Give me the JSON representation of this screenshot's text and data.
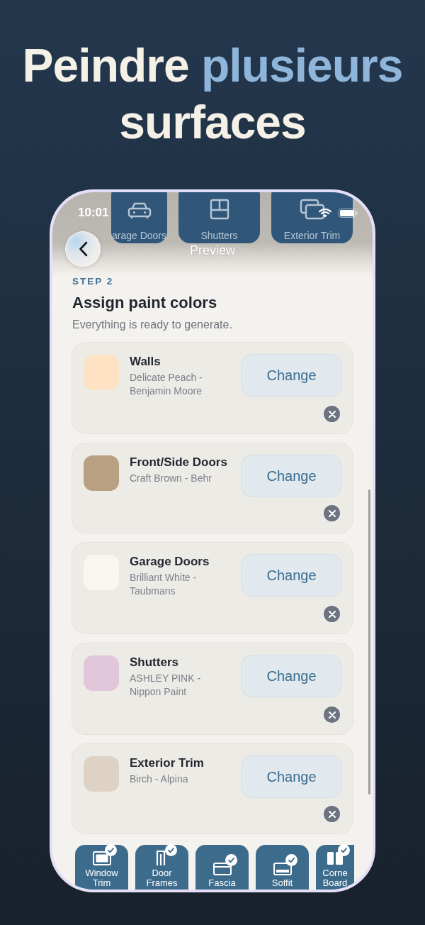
{
  "headline": {
    "lead": "Peindre",
    "highlight": "plusieurs",
    "tail": "surfaces"
  },
  "status_bar": {
    "time": "10:01"
  },
  "background_tiles": [
    {
      "label": "arage Doors"
    },
    {
      "label": "Shutters"
    },
    {
      "label": "Exterior Trim"
    }
  ],
  "nav": {
    "title": "Preview"
  },
  "step": {
    "label": "STEP 2",
    "title": "Assign paint colors",
    "subtitle": "Everything is ready to generate."
  },
  "assignments": [
    {
      "surface": "Walls",
      "paint": "Delicate Peach - Benjamin Moore",
      "color": "#fde2c3",
      "action": "Change"
    },
    {
      "surface": "Front/Side Doors",
      "paint": "Craft Brown - Behr",
      "color": "#b9a083",
      "action": "Change"
    },
    {
      "surface": "Garage Doors",
      "paint": "Brilliant White - Taubmans",
      "color": "#f7f6ef",
      "action": "Change"
    },
    {
      "surface": "Shutters",
      "paint": "ASHLEY PINK - Nippon Paint",
      "color": "#e2c6da",
      "action": "Change"
    },
    {
      "surface": "Exterior Trim",
      "paint": "Birch - Alpina",
      "color": "#ddd2c3",
      "action": "Change"
    }
  ],
  "surface_tiles": [
    {
      "label": "Window Trim",
      "checked": true
    },
    {
      "label": "Door Frames",
      "checked": true
    },
    {
      "label": "Fascia",
      "checked": true
    },
    {
      "label": "Soffit",
      "checked": true
    },
    {
      "label": "Corne Board",
      "checked": true
    }
  ]
}
